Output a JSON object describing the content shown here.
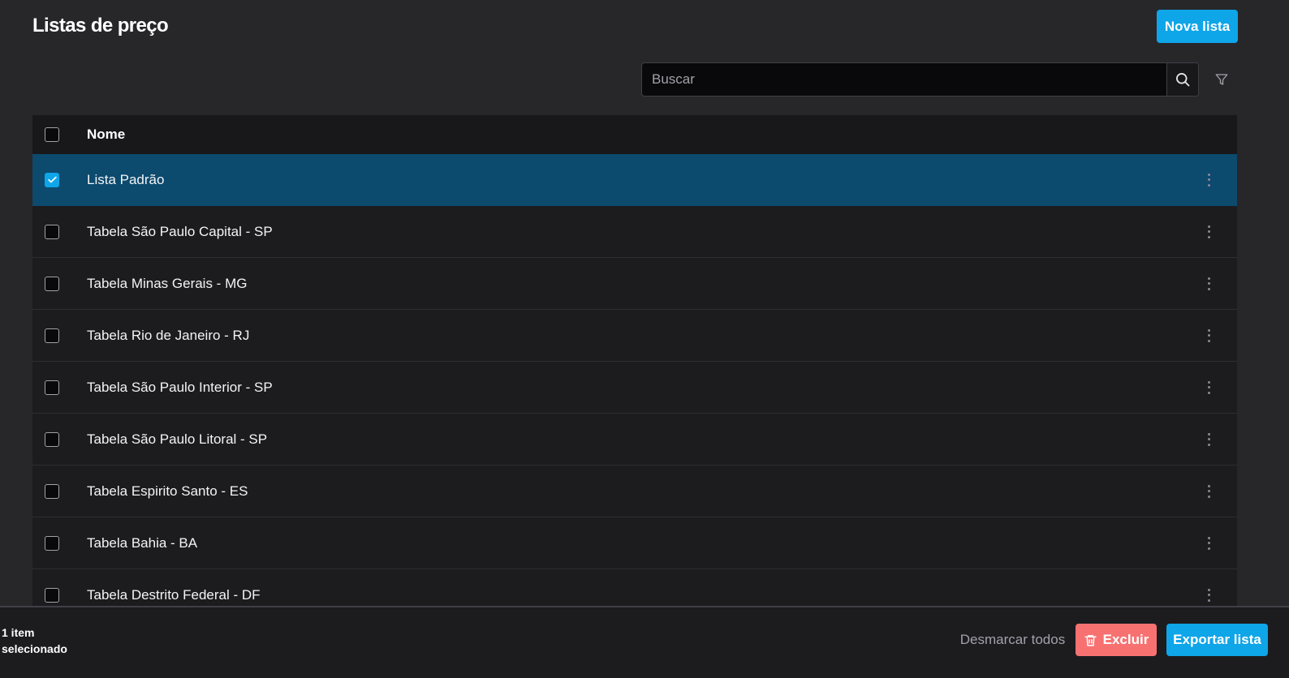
{
  "header": {
    "title": "Listas de preço",
    "new_button": "Nova lista"
  },
  "search": {
    "placeholder": "Buscar",
    "value": ""
  },
  "icons": {
    "search": "search-icon",
    "filter": "filter-icon",
    "check": "check-icon",
    "more": "more-vertical-icon",
    "trash": "trash-icon"
  },
  "table": {
    "column_name": "Nome",
    "rows": [
      {
        "name": "Lista Padrão",
        "selected": true
      },
      {
        "name": "Tabela São Paulo Capital - SP",
        "selected": false
      },
      {
        "name": "Tabela Minas Gerais - MG",
        "selected": false
      },
      {
        "name": "Tabela Rio de Janeiro - RJ",
        "selected": false
      },
      {
        "name": "Tabela São Paulo Interior - SP",
        "selected": false
      },
      {
        "name": "Tabela São Paulo Litoral - SP",
        "selected": false
      },
      {
        "name": "Tabela Espirito Santo - ES",
        "selected": false
      },
      {
        "name": "Tabela Bahia - BA",
        "selected": false
      },
      {
        "name": "Tabela Destrito Federal - DF",
        "selected": false
      }
    ]
  },
  "footer": {
    "selected_count": "1 item selecionado",
    "unselect_all": "Desmarcar todos",
    "delete": "Excluir",
    "export": "Exportar lista"
  },
  "colors": {
    "accent": "#0ea5e9",
    "selected_row": "#0c4a6e",
    "danger": "#f87171",
    "background": "#27272a"
  }
}
